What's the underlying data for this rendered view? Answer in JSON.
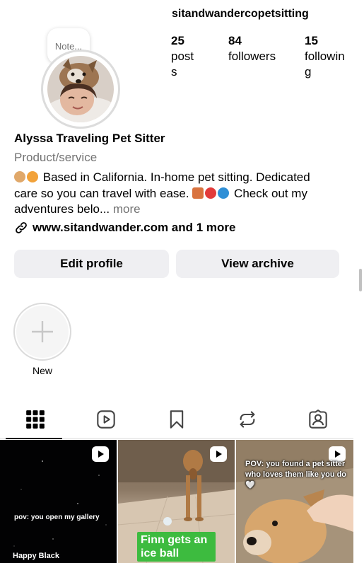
{
  "profile": {
    "username": "sitandwandercopetsitting",
    "full_name": "Alyssa Traveling Pet Sitter",
    "category": "Product/service",
    "note_placeholder": "Note...",
    "bio_line1": "Based in California. In-home pet sitting. Dedicated",
    "bio_line2": "care so you can travel with ease.",
    "bio_line2_tail": "Check out my",
    "bio_line3": "adventures belo...",
    "bio_more": "more",
    "link_text": "www.sitandwander.com and 1 more"
  },
  "stats": {
    "posts_count": "25",
    "posts_label": "posts",
    "followers_count": "84",
    "followers_label": "followers",
    "following_count": "15",
    "following_label": "following"
  },
  "actions": {
    "edit_profile": "Edit profile",
    "view_archive": "View archive"
  },
  "highlights": {
    "new_label": "New"
  },
  "tabs": [
    {
      "icon": "grid-icon",
      "active": true
    },
    {
      "icon": "reels-icon",
      "active": false
    },
    {
      "icon": "saved-icon",
      "active": false
    },
    {
      "icon": "reposts-icon",
      "active": false
    },
    {
      "icon": "tagged-icon",
      "active": false
    }
  ],
  "posts": [
    {
      "caption": "pov: you open my gallery",
      "sub": "Happy Black",
      "type": "reel"
    },
    {
      "caption": "Finn gets an ice ball",
      "type": "reel"
    },
    {
      "caption": "POV: you found a pet sitter who loves them like you do 🤍",
      "type": "reel"
    }
  ],
  "colors": {
    "button_bg": "#efeff2",
    "secondary_text": "#737373",
    "caption_green": "#3dbb3f"
  }
}
